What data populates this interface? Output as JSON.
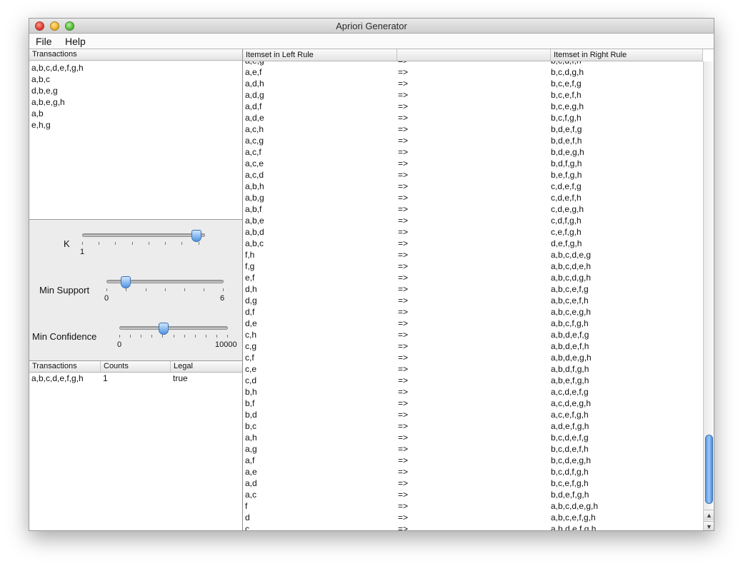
{
  "window": {
    "title": "Apriori Generator"
  },
  "menu": {
    "file": "File",
    "help": "Help"
  },
  "transactions_panel": {
    "header": "Transactions",
    "items": [
      "a,b,c,d,e,f,g,h",
      "a,b,c",
      "d,b,e,g",
      "a,b,e,g,h",
      "a,b",
      "e,h,g"
    ]
  },
  "sliders": {
    "k": {
      "label": "K",
      "min_label": "1",
      "value_fraction": 0.98
    },
    "min_support": {
      "label": "Min Support",
      "min_label": "0",
      "max_label": "6",
      "value": 1
    },
    "min_confidence": {
      "label": "Min Confidence",
      "min_label": "0",
      "max_label": "10000",
      "value_fraction": 0.41
    }
  },
  "counts_table": {
    "headers": [
      "Transactions",
      "Counts",
      "Legal"
    ],
    "rows": [
      {
        "transactions": "a,b,c,d,e,f,g,h",
        "counts": "1",
        "legal": "true"
      }
    ]
  },
  "rules_table": {
    "headers": {
      "left": "Itemset in Left Rule",
      "middle": "",
      "right": "Itemset in Right Rule"
    },
    "arrow": "=>",
    "rows": [
      [
        "a,e,g",
        "b,c,d,f,h"
      ],
      [
        "a,e,f",
        "b,c,d,g,h"
      ],
      [
        "a,d,h",
        "b,c,e,f,g"
      ],
      [
        "a,d,g",
        "b,c,e,f,h"
      ],
      [
        "a,d,f",
        "b,c,e,g,h"
      ],
      [
        "a,d,e",
        "b,c,f,g,h"
      ],
      [
        "a,c,h",
        "b,d,e,f,g"
      ],
      [
        "a,c,g",
        "b,d,e,f,h"
      ],
      [
        "a,c,f",
        "b,d,e,g,h"
      ],
      [
        "a,c,e",
        "b,d,f,g,h"
      ],
      [
        "a,c,d",
        "b,e,f,g,h"
      ],
      [
        "a,b,h",
        "c,d,e,f,g"
      ],
      [
        "a,b,g",
        "c,d,e,f,h"
      ],
      [
        "a,b,f",
        "c,d,e,g,h"
      ],
      [
        "a,b,e",
        "c,d,f,g,h"
      ],
      [
        "a,b,d",
        "c,e,f,g,h"
      ],
      [
        "a,b,c",
        "d,e,f,g,h"
      ],
      [
        "f,h",
        "a,b,c,d,e,g"
      ],
      [
        "f,g",
        "a,b,c,d,e,h"
      ],
      [
        "e,f",
        "a,b,c,d,g,h"
      ],
      [
        "d,h",
        "a,b,c,e,f,g"
      ],
      [
        "d,g",
        "a,b,c,e,f,h"
      ],
      [
        "d,f",
        "a,b,c,e,g,h"
      ],
      [
        "d,e",
        "a,b,c,f,g,h"
      ],
      [
        "c,h",
        "a,b,d,e,f,g"
      ],
      [
        "c,g",
        "a,b,d,e,f,h"
      ],
      [
        "c,f",
        "a,b,d,e,g,h"
      ],
      [
        "c,e",
        "a,b,d,f,g,h"
      ],
      [
        "c,d",
        "a,b,e,f,g,h"
      ],
      [
        "b,h",
        "a,c,d,e,f,g"
      ],
      [
        "b,f",
        "a,c,d,e,g,h"
      ],
      [
        "b,d",
        "a,c,e,f,g,h"
      ],
      [
        "b,c",
        "a,d,e,f,g,h"
      ],
      [
        "a,h",
        "b,c,d,e,f,g"
      ],
      [
        "a,g",
        "b,c,d,e,f,h"
      ],
      [
        "a,f",
        "b,c,d,e,g,h"
      ],
      [
        "a,e",
        "b,c,d,f,g,h"
      ],
      [
        "a,d",
        "b,c,e,f,g,h"
      ],
      [
        "a,c",
        "b,d,e,f,g,h"
      ],
      [
        "f",
        "a,b,c,d,e,g,h"
      ],
      [
        "d",
        "a,b,c,e,f,g,h"
      ],
      [
        "c",
        "a,b,d,e,f,g,h"
      ]
    ]
  },
  "scrollbar": {
    "up_glyph": "▲",
    "down_glyph": "▼",
    "position_fraction": 0.93
  }
}
